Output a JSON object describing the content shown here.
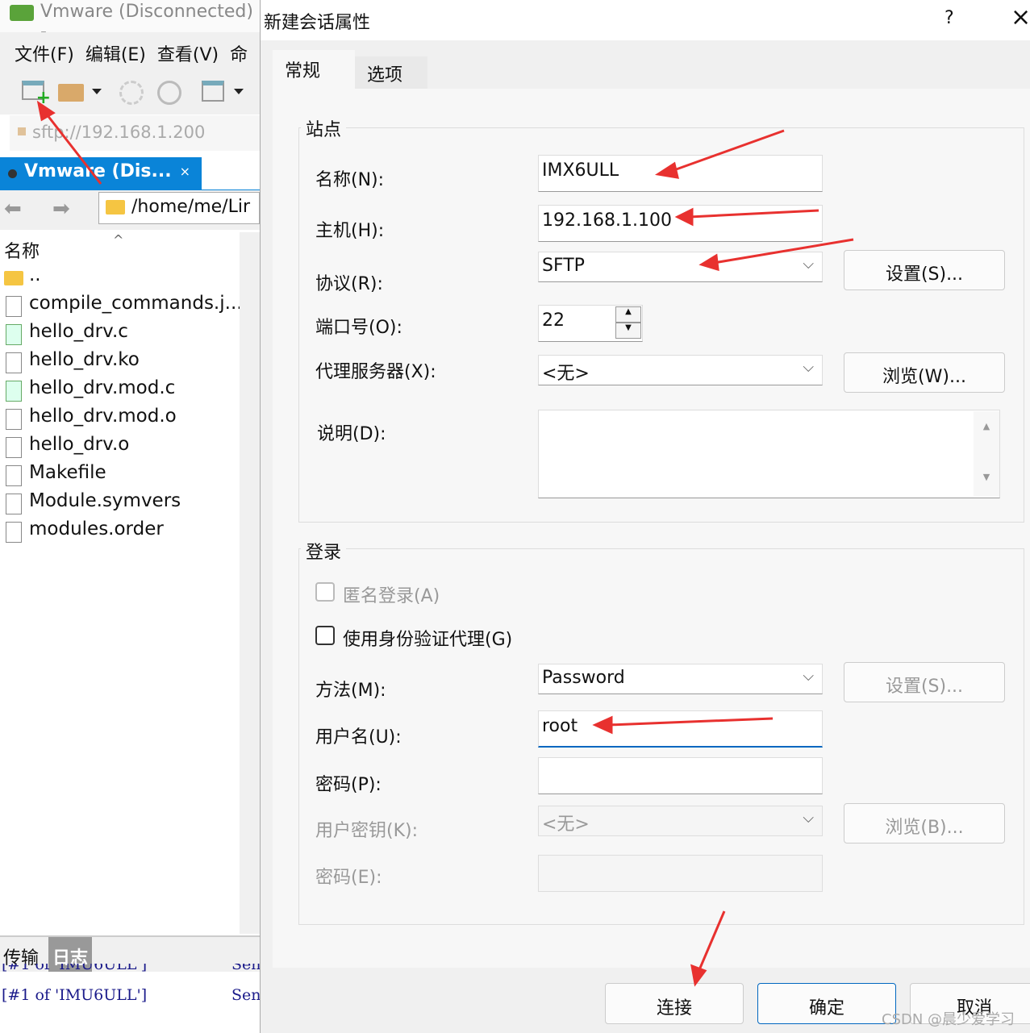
{
  "app": {
    "title": "Vmware (Disconnected) -",
    "menu": [
      "文件(F)",
      "编辑(E)",
      "查看(V)",
      "命"
    ],
    "address": "sftp://192.168.1.200",
    "session_tab": "Vmware (Dis...",
    "session_close": "×",
    "path": "/home/me/Lir",
    "column_name": "名称",
    "files": [
      {
        "name": "..",
        "type": "folder"
      },
      {
        "name": "compile_commands.j...",
        "type": "json"
      },
      {
        "name": "hello_drv.c",
        "type": "c"
      },
      {
        "name": "hello_drv.ko",
        "type": "file"
      },
      {
        "name": "hello_drv.mod.c",
        "type": "c"
      },
      {
        "name": "hello_drv.mod.o",
        "type": "file"
      },
      {
        "name": "hello_drv.o",
        "type": "file"
      },
      {
        "name": "Makefile",
        "type": "file"
      },
      {
        "name": "Module.symvers",
        "type": "file"
      },
      {
        "name": "modules.order",
        "type": "file"
      }
    ],
    "bottom_tabs": [
      "传输",
      "日志"
    ],
    "log": [
      {
        "src": "[#1 of 'IMU6ULL']",
        "msg": "Sen"
      },
      {
        "src": "[#1 of 'IMU6ULL']",
        "msg": "Sen"
      }
    ]
  },
  "dialog": {
    "title": "新建会话属性",
    "help": "?",
    "close": "×",
    "tabs": [
      "常规",
      "选项"
    ],
    "site": {
      "group": "站点",
      "name_label": "名称(N):",
      "name": "IMX6ULL",
      "host_label": "主机(H):",
      "host": "192.168.1.100",
      "protocol_label": "协议(R):",
      "protocol": "SFTP",
      "settings": "设置(S)...",
      "port_label": "端口号(O):",
      "port": "22",
      "proxy_label": "代理服务器(X):",
      "proxy": "<无>",
      "browse": "浏览(W)...",
      "desc_label": "说明(D):",
      "desc": ""
    },
    "login": {
      "group": "登录",
      "anonymous": "匿名登录(A)",
      "agent": "使用身份验证代理(G)",
      "method_label": "方法(M):",
      "method": "Password",
      "settings": "设置(S)...",
      "user_label": "用户名(U):",
      "user": "root",
      "pass_label": "密码(P):",
      "pass": "",
      "key_label": "用户密钥(K):",
      "key": "<无>",
      "browse": "浏览(B)...",
      "passphrase_label": "密码(E):"
    },
    "buttons": {
      "connect": "连接",
      "ok": "确定",
      "cancel": "取消"
    }
  },
  "watermark": "CSDN @晨少爱学习",
  "annotation_color": "#e8312f"
}
